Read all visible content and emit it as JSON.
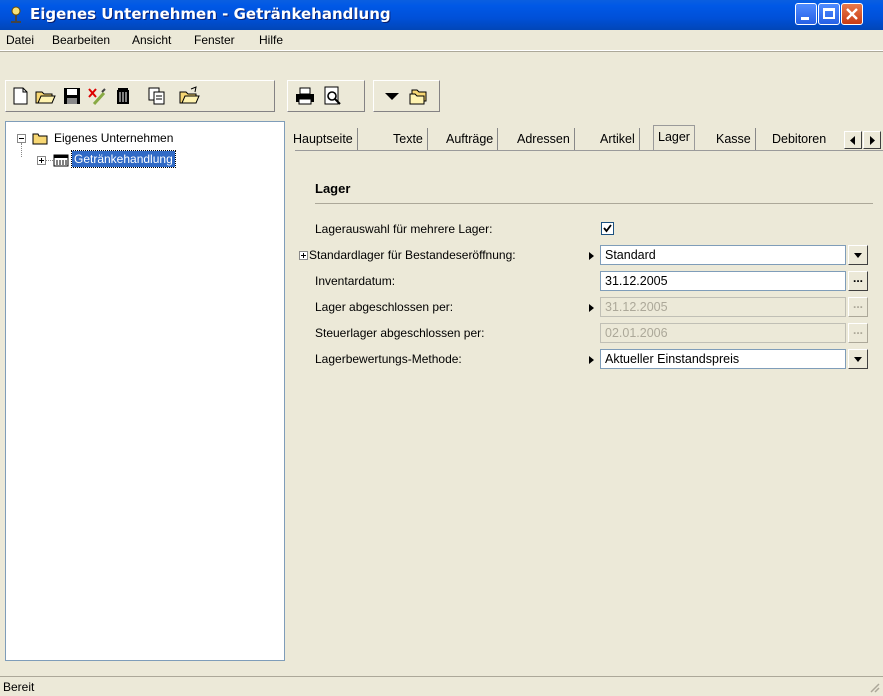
{
  "window": {
    "title": "Eigenes Unternehmen - Getränkehandlung"
  },
  "menu": [
    {
      "label": "Datei"
    },
    {
      "label": "Bearbeiten"
    },
    {
      "label": "Ansicht"
    },
    {
      "label": "Fenster"
    },
    {
      "label": "Hilfe"
    }
  ],
  "toolbar": {
    "buttons": [
      "new-document-icon",
      "open-folder-icon",
      "save-icon",
      "delete-mark-icon",
      "trash-icon",
      "copy-icon",
      "open-icon",
      "print-icon",
      "print-preview-icon",
      "dropdown-arrow-icon",
      "folder-tree-icon"
    ]
  },
  "tree": {
    "root": {
      "label": "Eigenes Unternehmen"
    },
    "child": {
      "label": "Getränkehandlung"
    }
  },
  "tabs": [
    "Hauptseite",
    "Texte",
    "Aufträge",
    "Adressen",
    "Artikel",
    "Lager",
    "Kasse",
    "Debitoren"
  ],
  "active_tab": "Lager",
  "lager": {
    "section_title": "Lager",
    "rows": [
      {
        "label": "Lagerauswahl für mehrere Lager:",
        "type": "checkbox",
        "checked": true
      },
      {
        "label": "Standardlager für Bestandeseröffnung:",
        "type": "dropdown",
        "value": "Standard"
      },
      {
        "label": "Inventardatum:",
        "type": "date",
        "value": "31.12.2005"
      },
      {
        "label": "Lager abgeschlossen per:",
        "type": "date",
        "value": "31.12.2005",
        "disabled": true
      },
      {
        "label": "Steuerlager abgeschlossen per:",
        "type": "date",
        "value": "02.01.2006",
        "disabled": true
      },
      {
        "label": "Lagerbewertungs-Methode:",
        "type": "dropdown",
        "value": "Aktueller Einstandspreis"
      }
    ]
  },
  "status": {
    "text": "Bereit"
  },
  "colors": {
    "caption": "#0054e3",
    "close": "#c93b14",
    "selection": "#316ac5"
  }
}
